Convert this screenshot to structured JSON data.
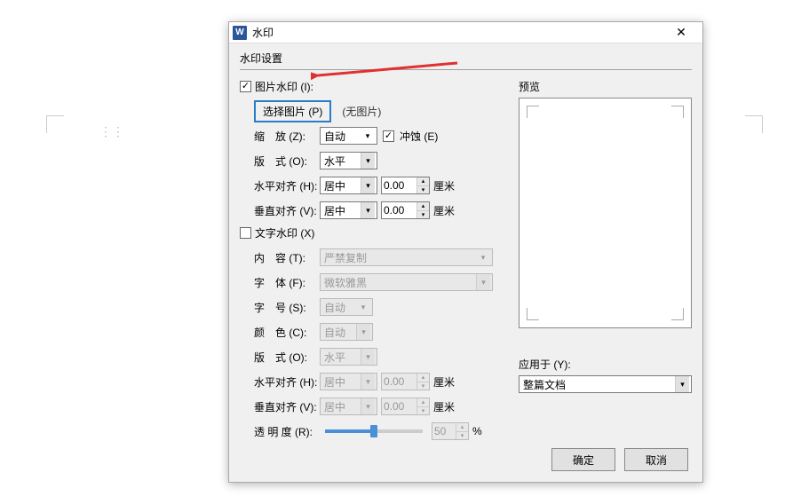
{
  "dialog": {
    "title": "水印",
    "group_title": "水印设置"
  },
  "image_wm": {
    "checkbox_label": "图片水印 (I):",
    "select_btn": "选择图片 (P)",
    "no_image": "(无图片)",
    "zoom_label": "缩　放 (Z):",
    "zoom_value": "自动",
    "erosion_label": "冲蚀 (E)",
    "layout_label": "版　式 (O):",
    "layout_value": "水平",
    "halign_label": "水平对齐 (H):",
    "halign_value": "居中",
    "halign_offset": "0.00",
    "halign_unit": "厘米",
    "valign_label": "垂直对齐 (V):",
    "valign_value": "居中",
    "valign_offset": "0.00",
    "valign_unit": "厘米"
  },
  "text_wm": {
    "checkbox_label": "文字水印 (X)",
    "content_label": "内　容 (T):",
    "content_value": "严禁复制",
    "font_label": "字　体 (F):",
    "font_value": "微软雅黑",
    "size_label": "字　号 (S):",
    "size_value": "自动",
    "color_label": "颜　色 (C):",
    "color_value": "自动",
    "layout_label": "版　式 (O):",
    "layout_value": "水平",
    "halign_label": "水平对齐 (H):",
    "halign_value": "居中",
    "halign_offset": "0.00",
    "halign_unit": "厘米",
    "valign_label": "垂直对齐 (V):",
    "valign_value": "居中",
    "valign_offset": "0.00",
    "valign_unit": "厘米",
    "opacity_label": "透 明 度 (R):",
    "opacity_value": "50",
    "opacity_unit": "%"
  },
  "preview": {
    "label": "预览"
  },
  "apply": {
    "label": "应用于 (Y):",
    "value": "整篇文档"
  },
  "footer": {
    "ok": "确定",
    "cancel": "取消"
  }
}
